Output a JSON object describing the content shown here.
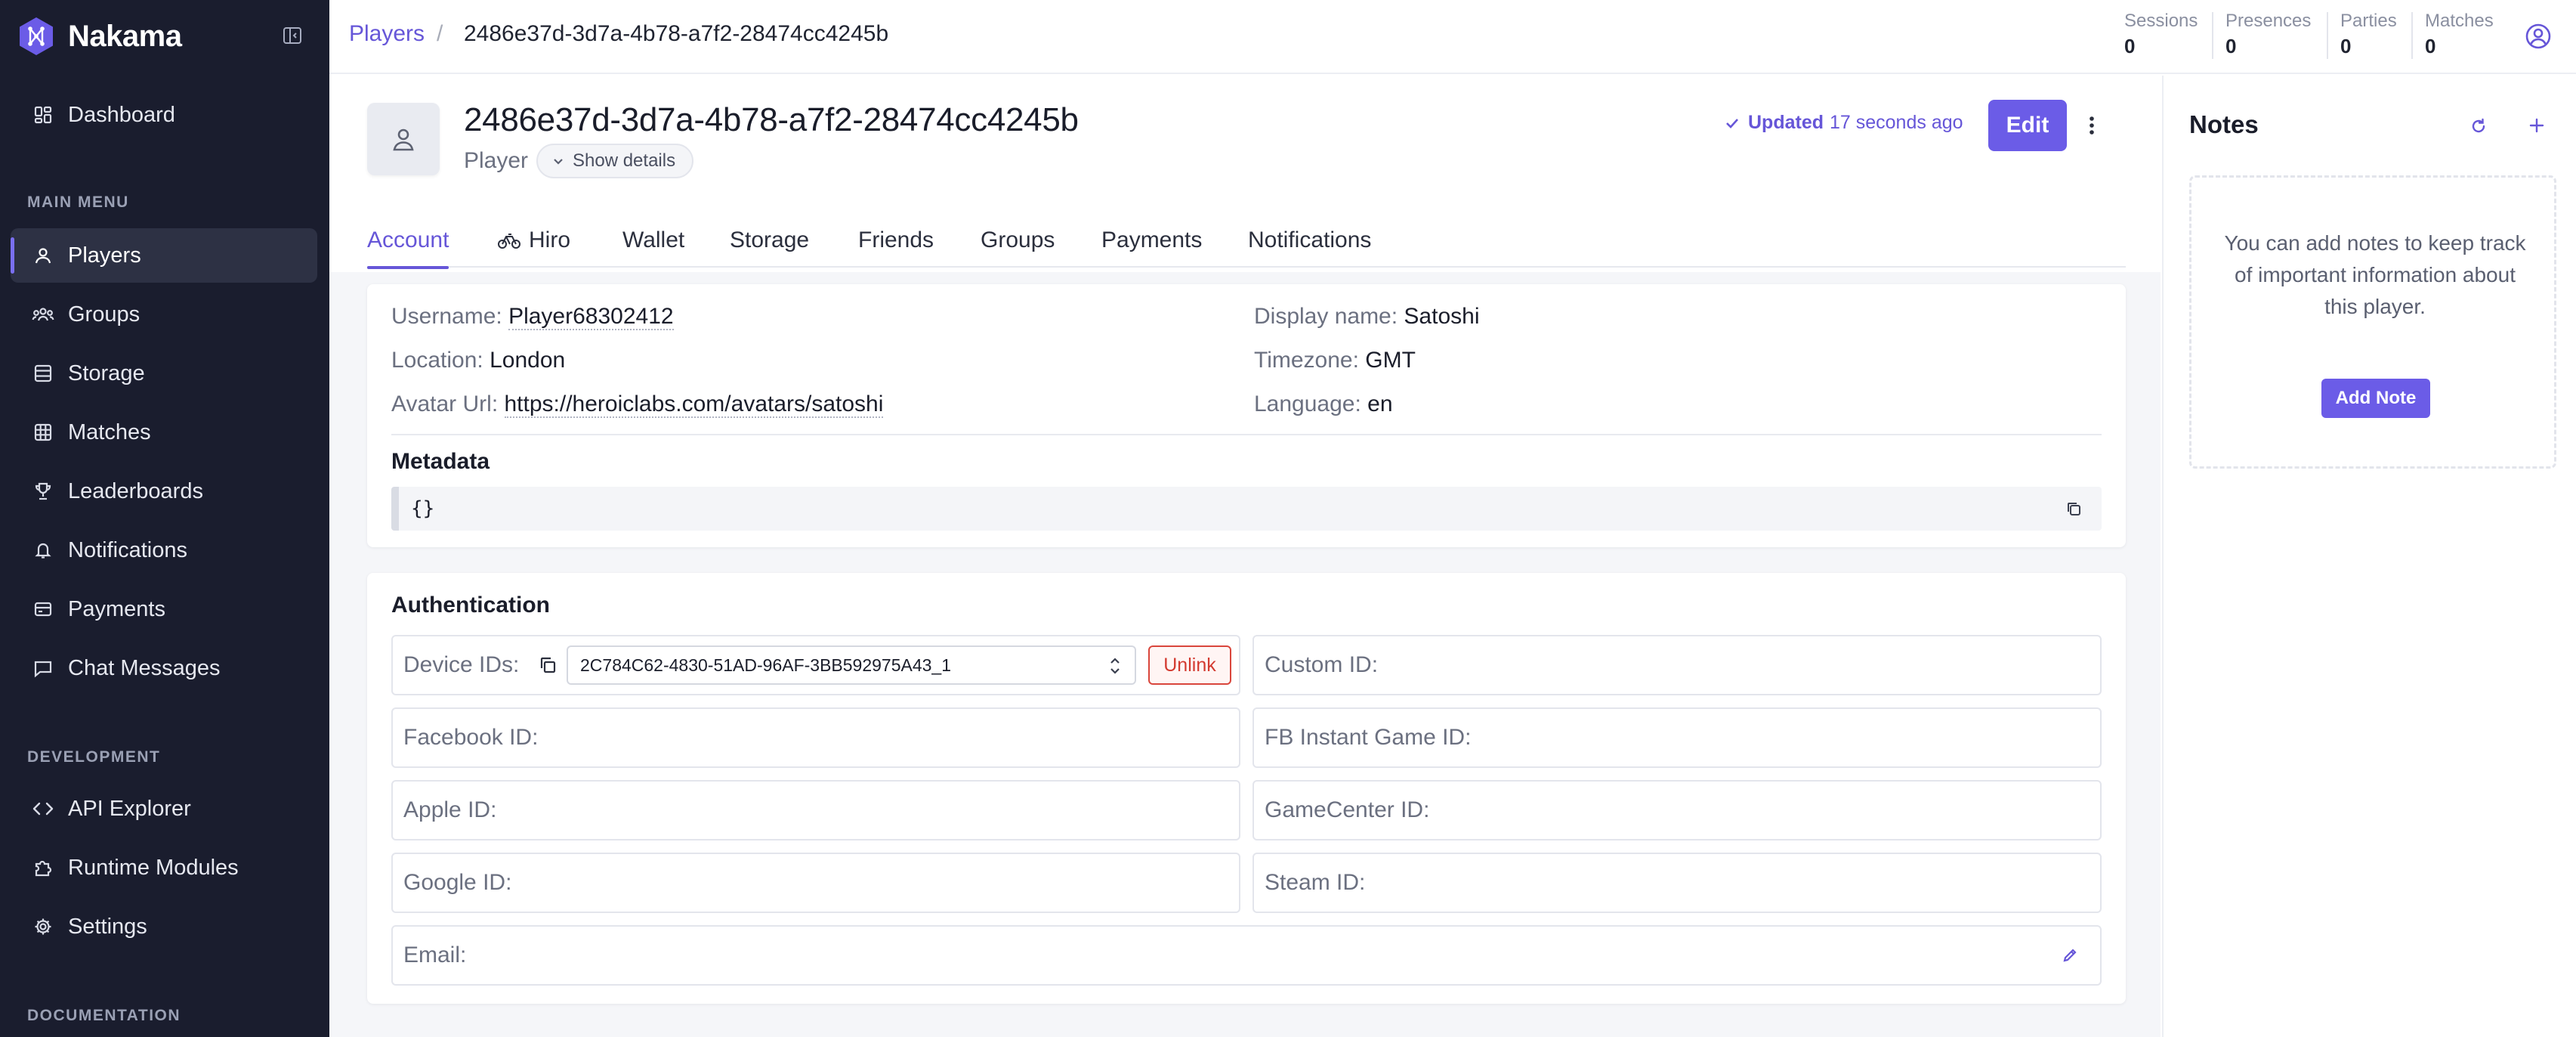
{
  "brand": {
    "name": "Nakama",
    "accent": "#6b5ce7"
  },
  "sidebar": {
    "dashboard": "Dashboard",
    "main_menu_label": "MAIN MENU",
    "main_menu": [
      {
        "label": "Players",
        "icon": "user-icon",
        "active": true
      },
      {
        "label": "Groups",
        "icon": "users-icon"
      },
      {
        "label": "Storage",
        "icon": "database-icon"
      },
      {
        "label": "Matches",
        "icon": "grid-icon"
      },
      {
        "label": "Leaderboards",
        "icon": "trophy-icon"
      },
      {
        "label": "Notifications",
        "icon": "bell-icon"
      },
      {
        "label": "Payments",
        "icon": "receipt-icon"
      },
      {
        "label": "Chat Messages",
        "icon": "chat-icon"
      }
    ],
    "development_label": "DEVELOPMENT",
    "development": [
      {
        "label": "API Explorer",
        "icon": "code-icon"
      },
      {
        "label": "Runtime Modules",
        "icon": "puzzle-icon"
      },
      {
        "label": "Settings",
        "icon": "gear-icon"
      }
    ],
    "documentation_label": "DOCUMENTATION"
  },
  "header": {
    "breadcrumb_root": "Players",
    "breadcrumb_sep": "/",
    "breadcrumb_current": "2486e37d-3d7a-4b78-a7f2-28474cc4245b",
    "stats": [
      {
        "label": "Sessions",
        "value": "0"
      },
      {
        "label": "Presences",
        "value": "0"
      },
      {
        "label": "Parties",
        "value": "0"
      },
      {
        "label": "Matches",
        "value": "0"
      }
    ]
  },
  "player": {
    "id": "2486e37d-3d7a-4b78-a7f2-28474cc4245b",
    "role": "Player",
    "show_details": "Show details",
    "updated_label": "Updated",
    "updated_time": "17 seconds ago",
    "edit_label": "Edit"
  },
  "tabs": [
    "Account",
    "Hiro",
    "Wallet",
    "Storage",
    "Friends",
    "Groups",
    "Payments",
    "Notifications"
  ],
  "account": {
    "username_label": "Username:",
    "username": "Player68302412",
    "location_label": "Location:",
    "location": "London",
    "avatar_label": "Avatar Url:",
    "avatar_url": "https://heroiclabs.com/avatars/satoshi",
    "display_name_label": "Display name:",
    "display_name": "Satoshi",
    "timezone_label": "Timezone:",
    "timezone": "GMT",
    "language_label": "Language:",
    "language": "en",
    "metadata_label": "Metadata",
    "metadata": "{}"
  },
  "auth": {
    "title": "Authentication",
    "device_ids_label": "Device IDs:",
    "device_id_selected": "2C784C62-4830-51AD-96AF-3BB592975A43_1",
    "unlink_label": "Unlink",
    "custom_id": "Custom ID:",
    "facebook_id": "Facebook ID:",
    "fb_instant_id": "FB Instant Game ID:",
    "apple_id": "Apple ID:",
    "gamecenter_id": "GameCenter ID:",
    "google_id": "Google ID:",
    "steam_id": "Steam ID:",
    "email": "Email:"
  },
  "notes": {
    "title": "Notes",
    "empty_message": "You can add notes to keep track of important information about this player.",
    "add_label": "Add Note"
  }
}
